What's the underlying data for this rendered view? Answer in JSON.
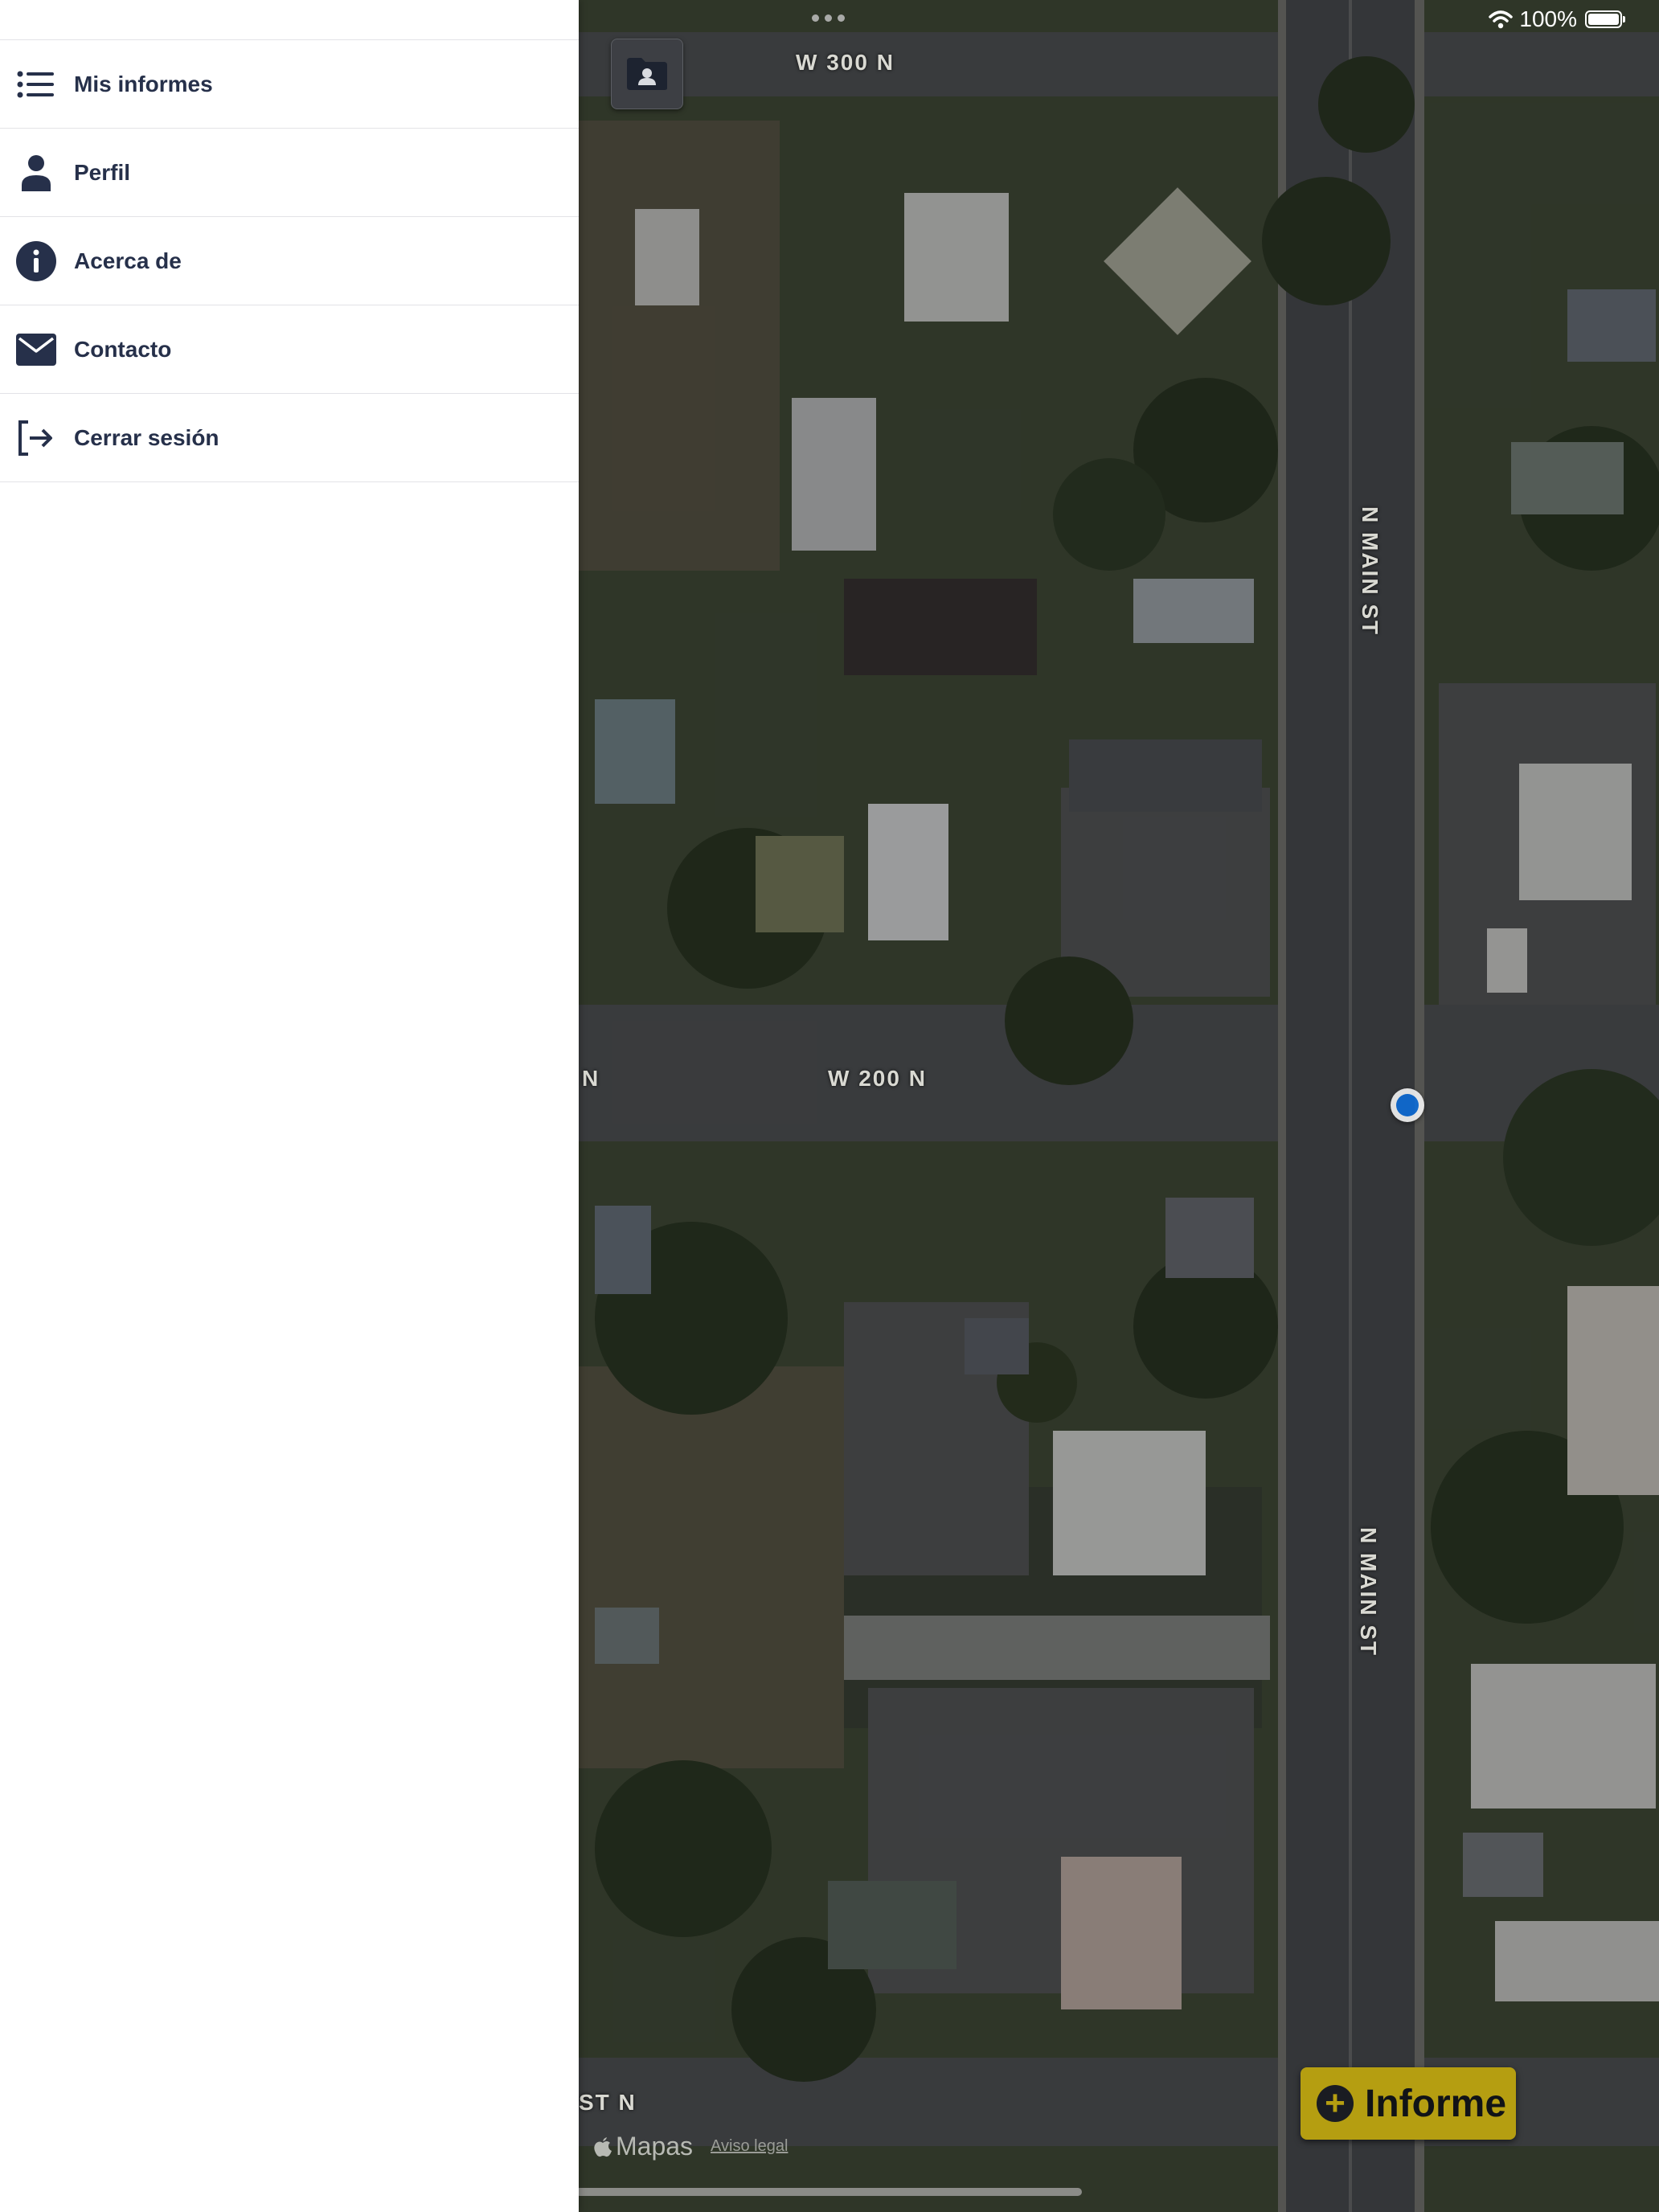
{
  "status_bar": {
    "battery_percent": "100%",
    "battery_level": 1.0,
    "wifi": "wifi-icon"
  },
  "sidebar": {
    "items": [
      {
        "label": "Mis informes",
        "icon": "list-icon"
      },
      {
        "label": "Perfil",
        "icon": "person-icon"
      },
      {
        "label": "Acerca de",
        "icon": "info-icon"
      },
      {
        "label": "Contacto",
        "icon": "mail-icon"
      },
      {
        "label": "Cerrar sesión",
        "icon": "logout-icon"
      }
    ]
  },
  "map": {
    "road_labels": {
      "w300n": "W 300 N",
      "w200n": "W 200 N",
      "n_edge": "N",
      "main_st_upper": "N MAIN ST",
      "main_st_lower": "N MAIN ST",
      "st_n": "ST N"
    },
    "attribution": {
      "brand": "Mapas",
      "legal": "Aviso legal"
    },
    "report_button": {
      "label": "Informe"
    }
  },
  "colors": {
    "sidebar_text": "#26304a",
    "report_button": "#b59e11",
    "location_dot": "#0a6fe0"
  }
}
